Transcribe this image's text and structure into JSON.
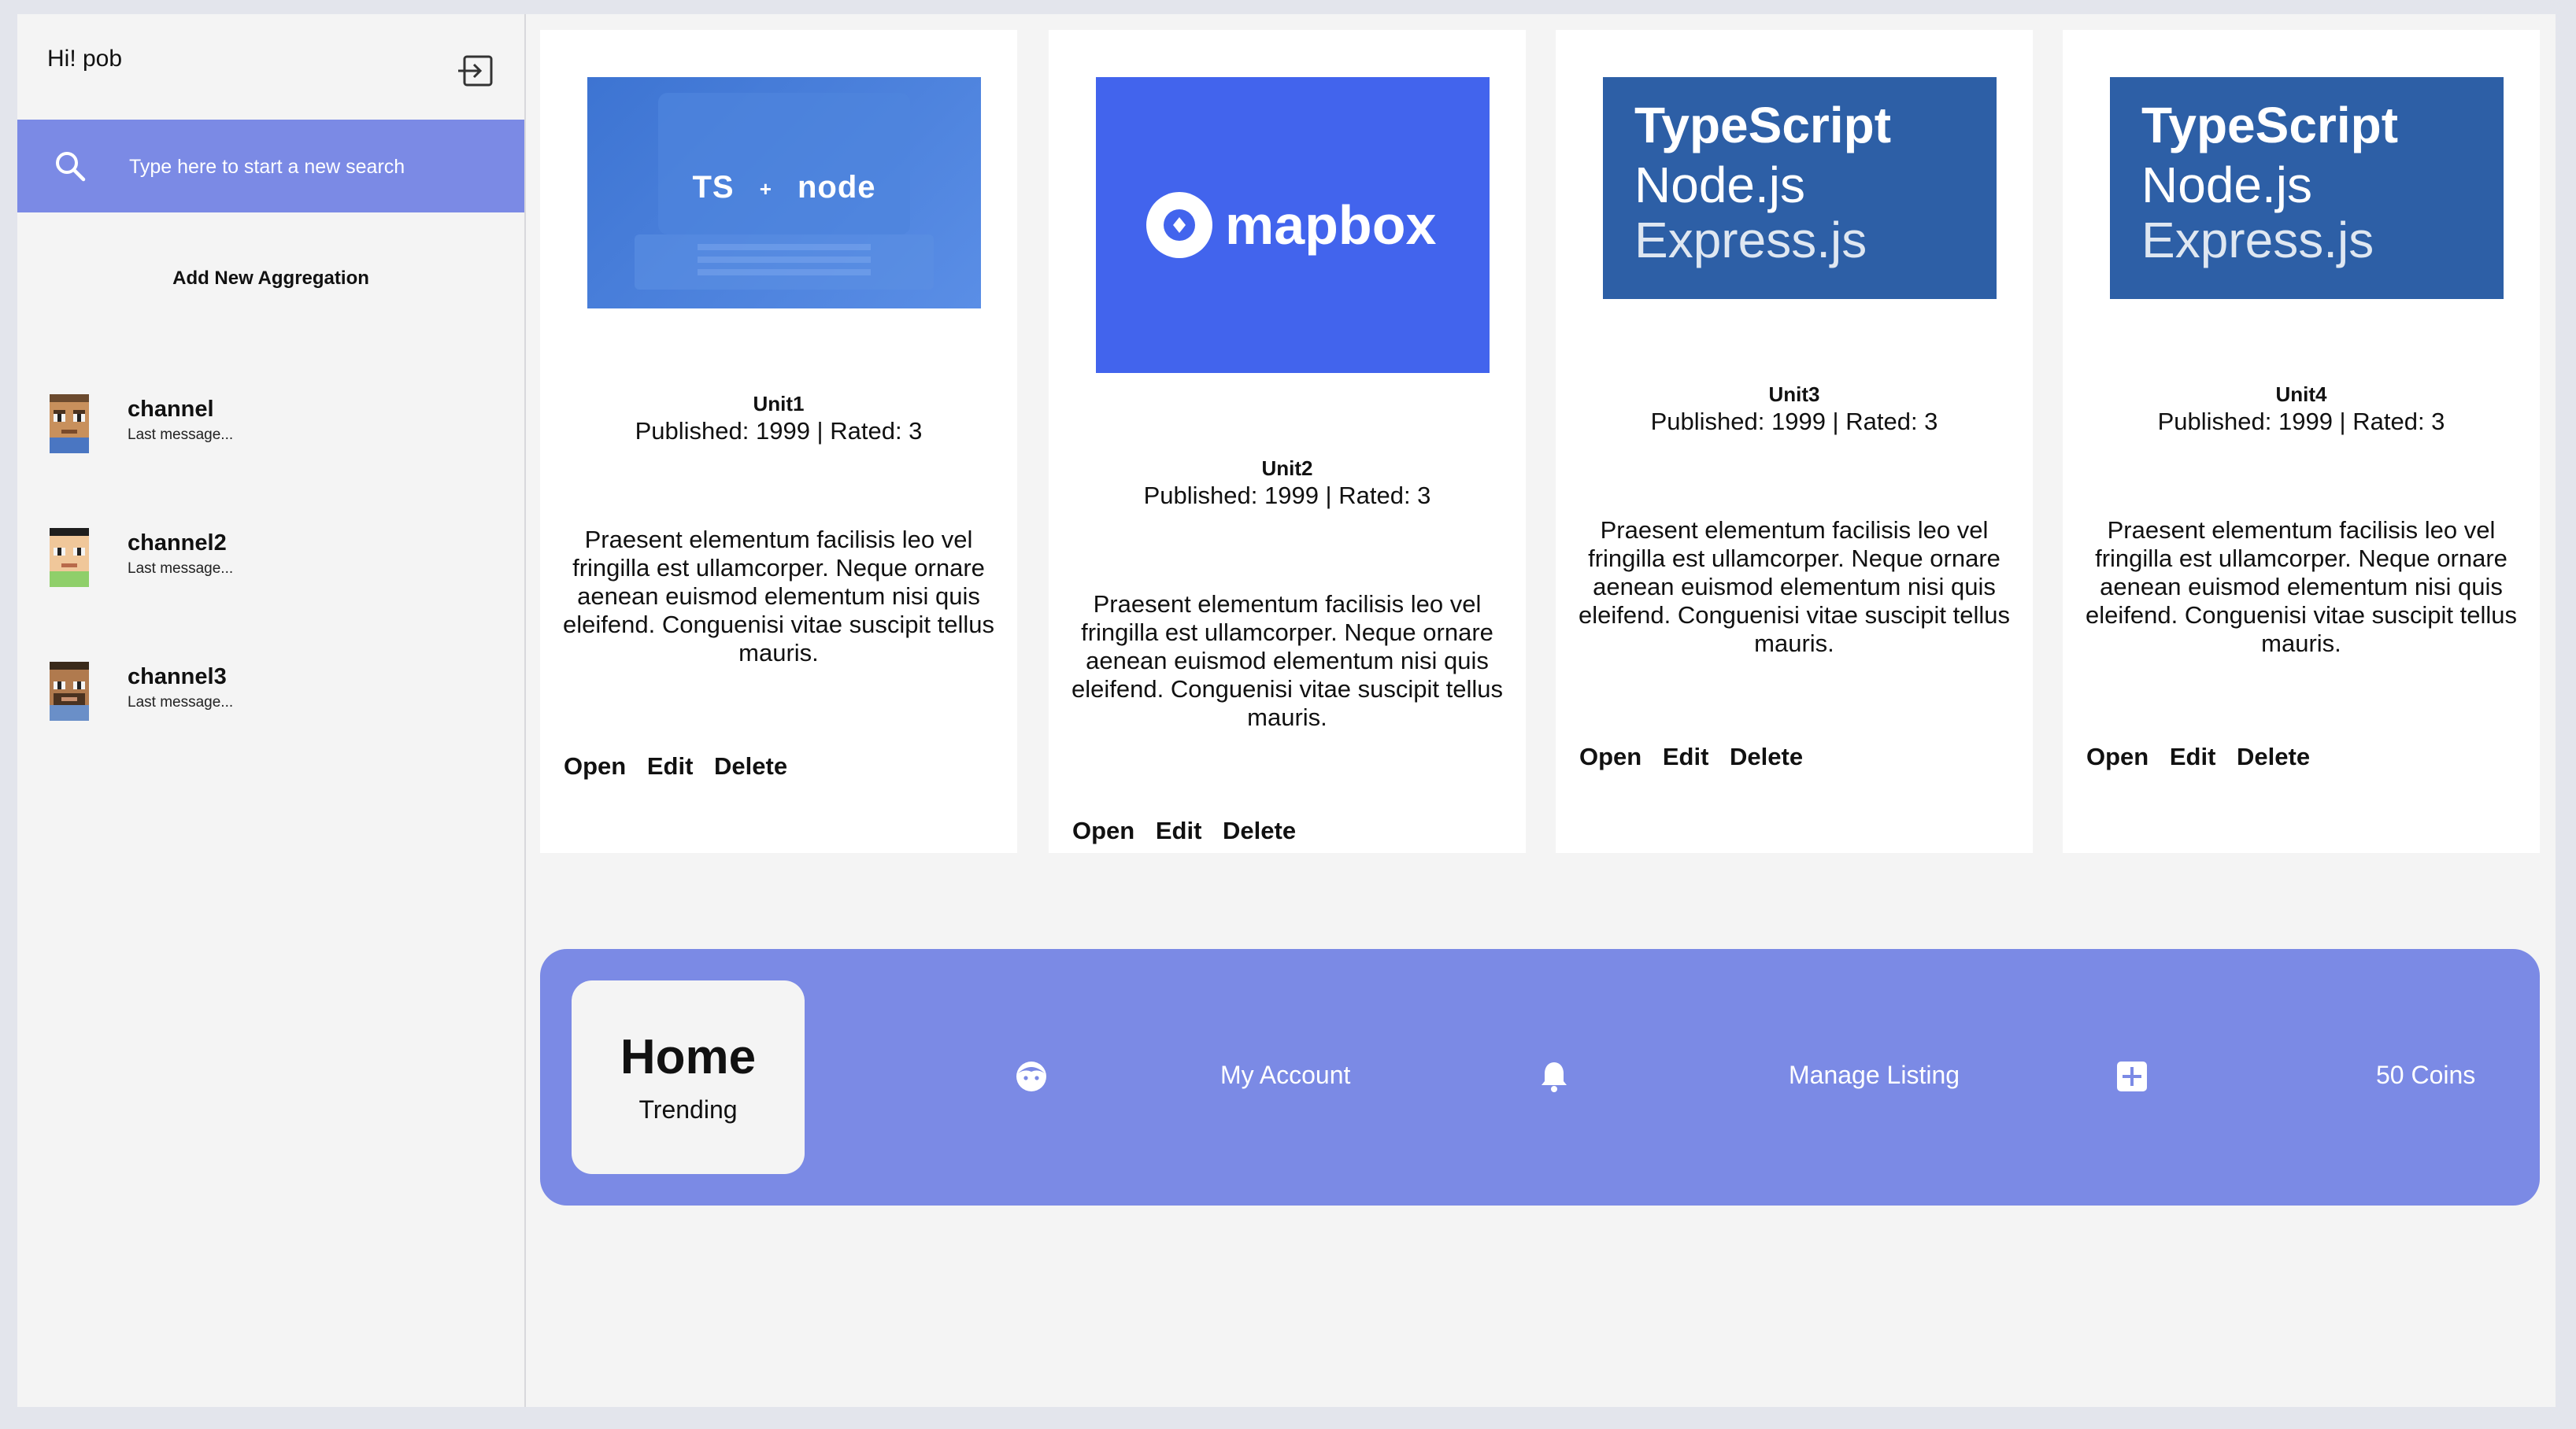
{
  "sidebar": {
    "greeting": "Hi! pob",
    "search_placeholder": "Type here to start a new search",
    "add_aggregation": "Add New Aggregation",
    "channels": [
      {
        "name": "channel",
        "last_message": "Last message..."
      },
      {
        "name": "channel2",
        "last_message": "Last message..."
      },
      {
        "name": "channel3",
        "last_message": "Last message..."
      }
    ]
  },
  "cards": [
    {
      "title": "Unit1",
      "meta": "Published: 1999 | Rated: 3",
      "description": "Praesent elementum facilisis leo vel fringilla est ullamcorper. Neque ornare aenean euismod elementum nisi quis eleifend. Conguenisi vitae suscipit tellus mauris.",
      "thumbnail": {
        "left": "TS",
        "plus": "+",
        "right": "node"
      },
      "actions": {
        "open": "Open",
        "edit": "Edit",
        "delete": "Delete"
      }
    },
    {
      "title": "Unit2",
      "meta": "Published: 1999 | Rated: 3",
      "description": "Praesent elementum facilisis leo vel fringilla est ullamcorper. Neque ornare aenean euismod elementum nisi quis eleifend. Conguenisi vitae suscipit tellus mauris.",
      "thumbnail": {
        "brand": "mapbox"
      },
      "actions": {
        "open": "Open",
        "edit": "Edit",
        "delete": "Delete"
      }
    },
    {
      "title": "Unit3",
      "meta": "Published: 1999 | Rated: 3",
      "description": "Praesent elementum facilisis leo vel fringilla est ullamcorper. Neque ornare aenean euismod elementum nisi quis eleifend. Conguenisi vitae suscipit tellus mauris.",
      "thumbnail": {
        "line1": "TypeScript",
        "line2": "Node.js",
        "line3": "Express.js"
      },
      "actions": {
        "open": "Open",
        "edit": "Edit",
        "delete": "Delete"
      }
    },
    {
      "title": "Unit4",
      "meta": "Published: 1999 | Rated: 3",
      "description": "Praesent elementum facilisis leo vel fringilla est ullamcorper. Neque ornare aenean euismod elementum nisi quis eleifend. Conguenisi vitae suscipit tellus mauris.",
      "thumbnail": {
        "line1": "TypeScript",
        "line2": "Node.js",
        "line3": "Express.js"
      },
      "actions": {
        "open": "Open",
        "edit": "Edit",
        "delete": "Delete"
      }
    }
  ],
  "bottom_nav": {
    "home": "Home",
    "home_sub": "Trending",
    "account_icon": "face-icon",
    "my_account": "My Account",
    "notifications_icon": "bell-icon",
    "manage_listing": "Manage Listing",
    "add_icon": "plus-square-icon",
    "coins": "50 Coins"
  },
  "colors": {
    "accent": "#7b8ae5",
    "background": "#f4f4f4",
    "card": "#ffffff",
    "mapbox": "#4264ed",
    "typescript_tile": "#2d5fa6"
  }
}
